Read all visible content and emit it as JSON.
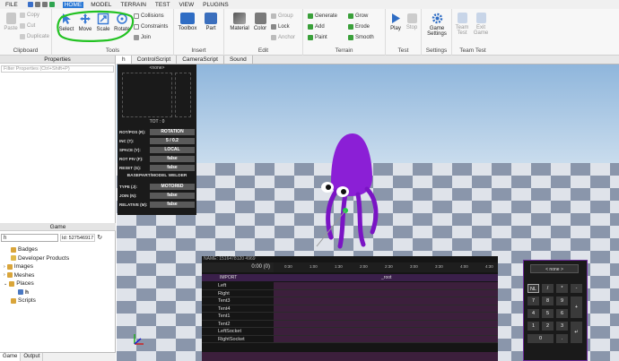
{
  "menu": [
    "FILE",
    "HOME",
    "MODEL",
    "TERRAIN",
    "TEST",
    "VIEW",
    "PLUGINS"
  ],
  "clipboard": {
    "paste": "Paste",
    "copy": "Copy",
    "cut": "Cut",
    "duplicate": "Duplicate",
    "label": "Clipboard"
  },
  "tools": {
    "select": "Select",
    "move": "Move",
    "scale": "Scale",
    "rotate": "Rotate",
    "collisions": "Collisions",
    "constraints": "Constraints",
    "join": "Join",
    "label": "Tools"
  },
  "insert": {
    "toolbox": "Toolbox",
    "part": "Part",
    "label": "Insert"
  },
  "edit": {
    "material": "Material",
    "color": "Color",
    "group": "Group",
    "lock": "Lock",
    "anchor": "Anchor",
    "label": "Edit"
  },
  "terrain": {
    "generate": "Generate",
    "add": "Add",
    "paint": "Paint",
    "grow": "Grow",
    "erode": "Erode",
    "smooth": "Smooth",
    "label": "Terrain"
  },
  "test": {
    "play": "Play",
    "stop": "Stop",
    "label": "Test"
  },
  "settings": {
    "game_settings": "Game Settings",
    "label": "Settings"
  },
  "team_test": {
    "team_test": "Team Test",
    "exit_game": "Exit Game",
    "label": "Team Test"
  },
  "properties": {
    "title": "Properties",
    "filter_placeholder": "Filter Properties (Ctrl+Shift+P)"
  },
  "game": {
    "title": "Game",
    "search_value": "h",
    "id_text": "Id: 527546917",
    "items": [
      "Badges",
      "Developer Products",
      "Images",
      "Meshes",
      "Places",
      "h",
      "Scripts"
    ]
  },
  "bottom_tabs": [
    "Game",
    "Output"
  ],
  "editor_tabs": [
    "h",
    "ControlScript",
    "CameraScript",
    "Sound"
  ],
  "gizmo": {
    "title": "<none>",
    "tot": "TOT : 0",
    "rows": [
      {
        "k": "ROT/POS (R):",
        "v": "ROTATION"
      },
      {
        "k": "INC (T):",
        "v": "5 / 0.2"
      },
      {
        "k": "SPACE (Y):",
        "v": "LOCAL"
      },
      {
        "k": "ROT PIV (F):",
        "v": "false"
      },
      {
        "k": "RESET (G):",
        "v": "false"
      }
    ],
    "section": "BASEPART/MODEL WELDER",
    "rows2": [
      {
        "k": "TYPE (J):",
        "v": "MOTOR6D"
      },
      {
        "k": "JOIN (N):",
        "v": "false"
      },
      {
        "k": "RELATIVE (M):",
        "v": "false"
      }
    ]
  },
  "timeline": {
    "name": "NAME: 1516478120 4969",
    "time": "0:00 (0)",
    "ticks": [
      "0:30",
      "1:00",
      "1:30",
      "2:00",
      "2:30",
      "3:00",
      "3:30",
      "4:00",
      "4:30"
    ],
    "import": "IMPORT",
    "root": "_root",
    "tracks": [
      "Left",
      "Right",
      "Tent3",
      "Tent4",
      "Tent1",
      "Tent2",
      "LeftSocket",
      "RightSocket"
    ]
  },
  "numpad": {
    "top": "< none >",
    "keys": [
      "NL",
      "/",
      "*",
      "-",
      "7",
      "8",
      "9",
      "+",
      "4",
      "5",
      "6",
      "1",
      "2",
      "3",
      "0",
      ".",
      "↵"
    ]
  },
  "colors": {
    "accent": "#2d7ad6",
    "squid": "#8b1fd6",
    "highlight": "#22c222"
  }
}
